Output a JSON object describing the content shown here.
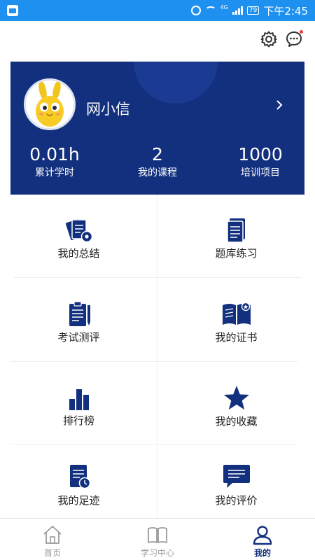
{
  "status_bar": {
    "battery": "79",
    "network": "4G",
    "time": "下午2:45"
  },
  "profile": {
    "username": "网小信",
    "stats": [
      {
        "value": "0.01h",
        "label": "累计学时"
      },
      {
        "value": "2",
        "label": "我的课程"
      },
      {
        "value": "1000",
        "label": "培训项目"
      }
    ]
  },
  "grid": [
    {
      "label": "我的总结",
      "icon": "summary-icon"
    },
    {
      "label": "题库练习",
      "icon": "question-bank-icon"
    },
    {
      "label": "考试测评",
      "icon": "exam-icon"
    },
    {
      "label": "我的证书",
      "icon": "certificate-icon"
    },
    {
      "label": "排行榜",
      "icon": "ranking-icon"
    },
    {
      "label": "我的收藏",
      "icon": "star-icon"
    },
    {
      "label": "我的足迹",
      "icon": "footprint-icon"
    },
    {
      "label": "我的评价",
      "icon": "comment-icon"
    }
  ],
  "bottom_nav": [
    {
      "label": "首页",
      "icon": "home-icon"
    },
    {
      "label": "学习中心",
      "icon": "book-icon"
    },
    {
      "label": "我的",
      "icon": "person-icon",
      "active": true
    }
  ],
  "colors": {
    "status_bar": "#1e90f0",
    "brand": "#13307e",
    "alert_dot": "#f03c3c"
  }
}
